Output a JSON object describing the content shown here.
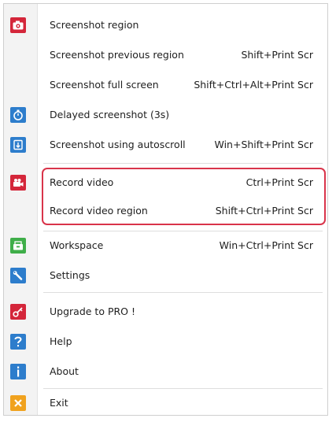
{
  "menu": {
    "items": [
      {
        "label": "Screenshot region",
        "shortcut": "",
        "icon": "camera-icon",
        "icon_color": "#d4263a"
      },
      {
        "label": "Screenshot previous region",
        "shortcut": "Shift+Print Scr",
        "icon": "",
        "icon_color": ""
      },
      {
        "label": "Screenshot full screen",
        "shortcut": "Shift+Ctrl+Alt+Print Scr",
        "icon": "",
        "icon_color": ""
      },
      {
        "label": "Delayed screenshot (3s)",
        "shortcut": "",
        "icon": "stopwatch-icon",
        "icon_color": "#2d7dcc"
      },
      {
        "label": "Screenshot using autoscroll",
        "shortcut": "Win+Shift+Print Scr",
        "icon": "autoscroll-icon",
        "icon_color": "#2d7dcc"
      },
      {
        "label": "Record video",
        "shortcut": "Ctrl+Print Scr",
        "icon": "video-camera-icon",
        "icon_color": "#d4263a"
      },
      {
        "label": "Record video region",
        "shortcut": "Shift+Ctrl+Print Scr",
        "icon": "",
        "icon_color": ""
      },
      {
        "label": "Workspace",
        "shortcut": "Win+Ctrl+Print Scr",
        "icon": "workspace-icon",
        "icon_color": "#3fae49"
      },
      {
        "label": "Settings",
        "shortcut": "",
        "icon": "wrench-icon",
        "icon_color": "#2d7dcc"
      },
      {
        "label": "Upgrade to PRO !",
        "shortcut": "",
        "icon": "key-icon",
        "icon_color": "#d4263a"
      },
      {
        "label": "Help",
        "shortcut": "",
        "icon": "question-icon",
        "icon_color": "#2d7dcc"
      },
      {
        "label": "About",
        "shortcut": "",
        "icon": "info-icon",
        "icon_color": "#2d7dcc"
      },
      {
        "label": "Exit",
        "shortcut": "",
        "icon": "close-icon",
        "icon_color": "#f0a21e"
      }
    ]
  },
  "highlight_color": "#d9344a"
}
